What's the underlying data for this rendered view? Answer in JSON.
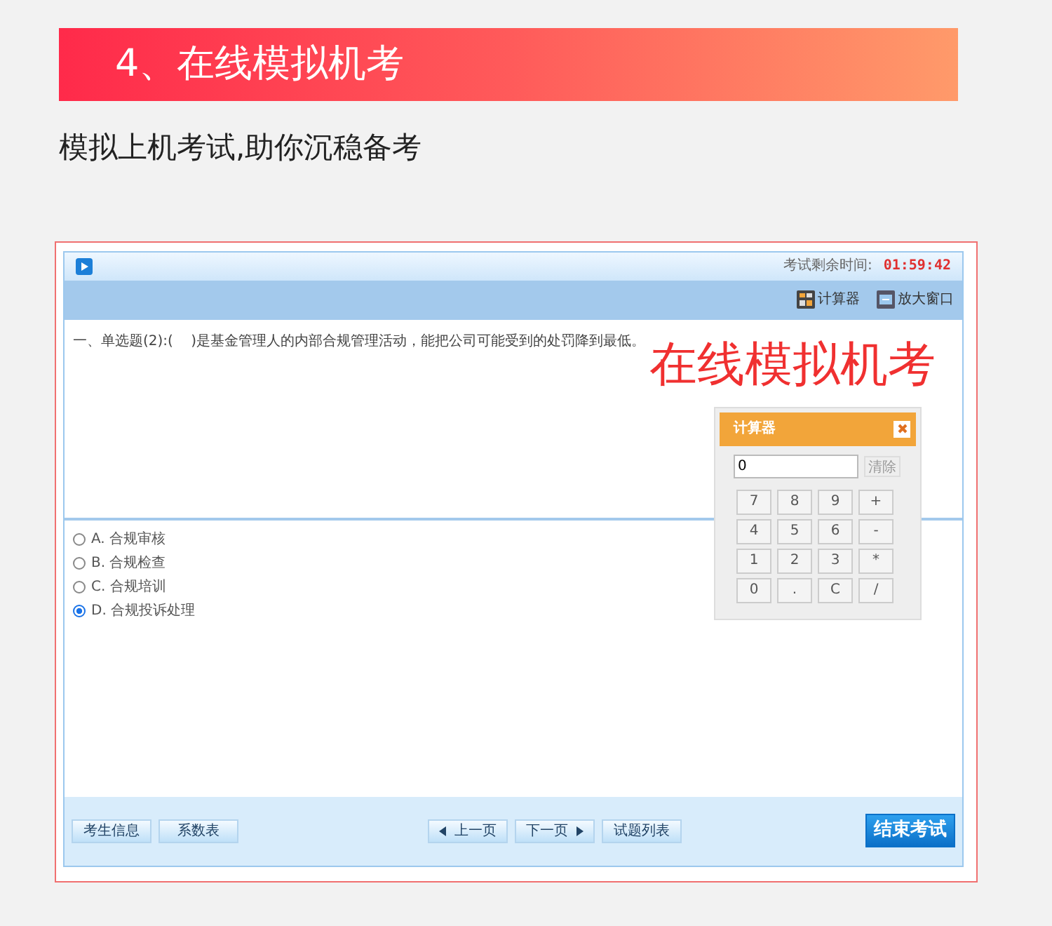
{
  "banner": {
    "title": "4、在线模拟机考"
  },
  "subtitle": "模拟上机考试,助你沉稳备考",
  "exam": {
    "time_label": "考试剩余时间:",
    "time_value": "01:59:42",
    "tools": [
      {
        "kind": "calculator",
        "label": "计算器"
      },
      {
        "kind": "enlarge",
        "label": "放大窗口"
      }
    ],
    "question": "一、单选题(2):(    )是基金管理人的内部合规管理活动，能把公司可能受到的处罚降到最低。",
    "options": [
      {
        "text": "A. 合规审核",
        "selected": false
      },
      {
        "text": "B. 合规检查",
        "selected": false
      },
      {
        "text": "C. 合规培训",
        "selected": false
      },
      {
        "text": "D. 合规投诉处理",
        "selected": true
      }
    ],
    "caption": "在线模拟机考",
    "calculator": {
      "title": "计算器",
      "display": "0",
      "action": "清除",
      "keys": [
        "7",
        "8",
        "9",
        "+",
        "4",
        "5",
        "6",
        "-",
        "1",
        "2",
        "3",
        "*",
        "0",
        ".",
        "C",
        "/"
      ]
    },
    "footer_buttons": [
      {
        "kind": "plain",
        "label": "考生信息"
      },
      {
        "kind": "plain",
        "label": "系数表"
      },
      {
        "kind": "prev",
        "label": "上一页"
      },
      {
        "kind": "next",
        "label": "下一页"
      },
      {
        "kind": "plain",
        "label": "试题列表"
      },
      {
        "kind": "primary",
        "label": "结束考试"
      }
    ]
  }
}
